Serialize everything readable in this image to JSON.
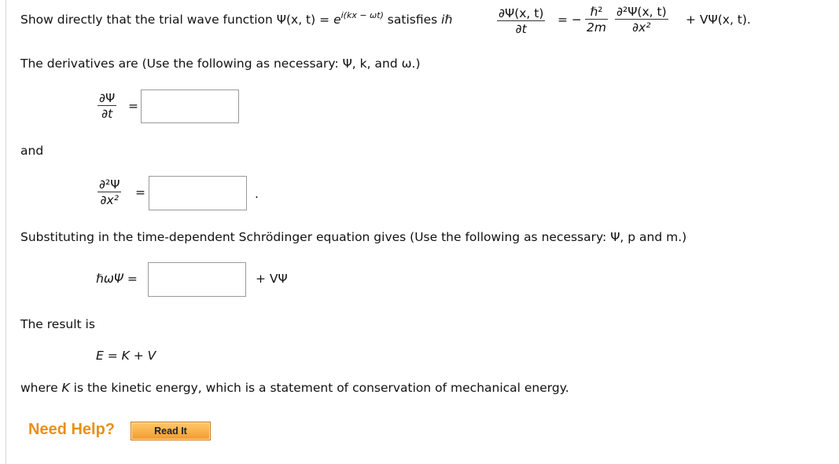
{
  "problem": {
    "intro_prefix": "Show directly that the trial wave function ",
    "psi_xt": "Ψ(x, t)",
    "eq": "=",
    "e_base": "e",
    "exponent": "i(kx − ωt)",
    "satisfies": " satisfies ",
    "ihbar": "iℏ",
    "lhs_num": "∂Ψ(x, t)",
    "lhs_den": "∂t",
    "eq_minus": "=  −",
    "coef_num": "ℏ²",
    "coef_den": "2m",
    "rhs_num": "∂²Ψ(x, t)",
    "rhs_den": "∂x²",
    "tail": "+ VΨ(x, t)."
  },
  "derivatives": {
    "intro": "The derivatives are (Use the following as necessary: Ψ, k, and ω.)",
    "dt_num": "∂Ψ",
    "dt_den": "∂t",
    "eq1": "=",
    "dt_answer": "",
    "and_label": "and",
    "dx2_num": "∂²Ψ",
    "dx2_den": "∂x²",
    "eq2": "=",
    "dx2_answer": "",
    "period": "."
  },
  "substitution": {
    "intro": "Substituting in the time-dependent Schrödinger equation gives (Use the following as necessary: Ψ, p and m.)",
    "lhs": "ℏωΨ =",
    "answer": "",
    "plus_v": "+ VΨ"
  },
  "result": {
    "label": "The result is",
    "equation": "E = K + V",
    "where_prefix": "where ",
    "k_var": "K",
    "where_suffix": " is the kinetic energy, which is a statement of conservation of mechanical energy."
  },
  "help": {
    "need_help": "Need Help?",
    "read_it": "Read It"
  },
  "colors": {
    "help_text": "#e8901a",
    "button_top": "#ffc96b",
    "button_bottom": "#f39b2d",
    "input_border": "#9a9a9a"
  }
}
